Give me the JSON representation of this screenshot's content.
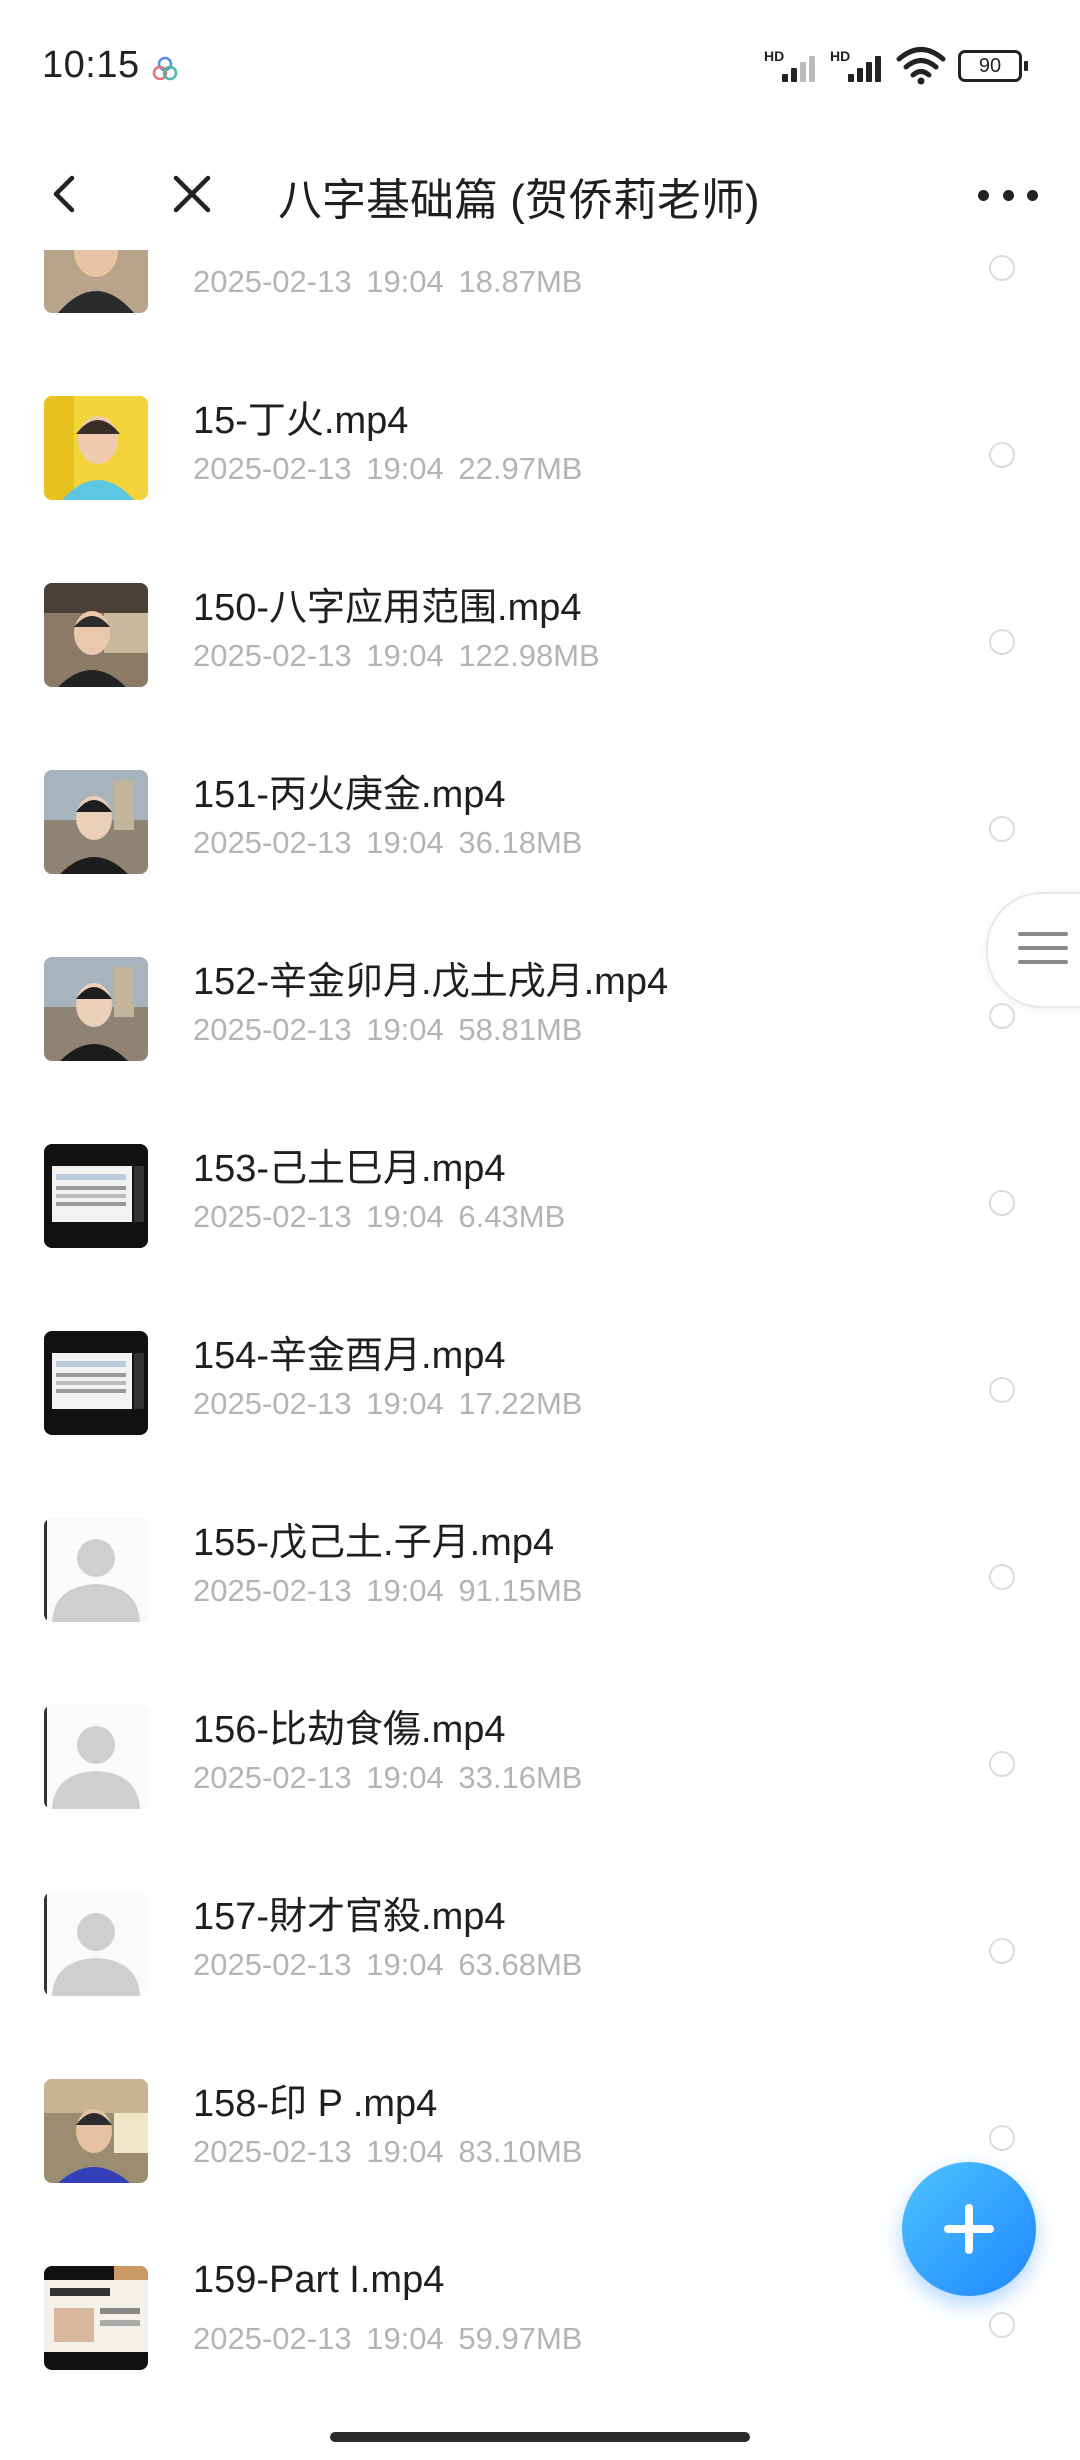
{
  "status_bar": {
    "time": "10:15",
    "signal_1_label": "HD",
    "signal_2_label": "HD",
    "battery": "90"
  },
  "header": {
    "title": "八字基础篇 (贺侨莉老师)",
    "back_icon": "chevron-left",
    "close_icon": "x",
    "more_icon": "ellipsis-horizontal"
  },
  "files": [
    {
      "name": "",
      "date": "2025-02-13",
      "time": "19:04",
      "size": "18.87MB",
      "thumb": "person-office"
    },
    {
      "name": "15-丁火.mp4",
      "date": "2025-02-13",
      "time": "19:04",
      "size": "22.97MB",
      "thumb": "person-yellow"
    },
    {
      "name": "150-八字应用范围.mp4",
      "date": "2025-02-13",
      "time": "19:04",
      "size": "122.98MB",
      "thumb": "person-room"
    },
    {
      "name": "151-丙火庚金.mp4",
      "date": "2025-02-13",
      "time": "19:04",
      "size": "36.18MB",
      "thumb": "person-city"
    },
    {
      "name": "152-辛金卯月.戊土戌月.mp4",
      "date": "2025-02-13",
      "time": "19:04",
      "size": "58.81MB",
      "thumb": "person-city"
    },
    {
      "name": "153-己土巳月.mp4",
      "date": "2025-02-13",
      "time": "19:04",
      "size": "6.43MB",
      "thumb": "screen-table"
    },
    {
      "name": "154-辛金酉月.mp4",
      "date": "2025-02-13",
      "time": "19:04",
      "size": "17.22MB",
      "thumb": "screen-table"
    },
    {
      "name": "155-戊己土.子月.mp4",
      "date": "2025-02-13",
      "time": "19:04",
      "size": "91.15MB",
      "thumb": "avatar-placeholder"
    },
    {
      "name": "156-比劫食傷.mp4",
      "date": "2025-02-13",
      "time": "19:04",
      "size": "33.16MB",
      "thumb": "avatar-placeholder"
    },
    {
      "name": "157-財才官殺.mp4",
      "date": "2025-02-13",
      "time": "19:04",
      "size": "63.68MB",
      "thumb": "avatar-placeholder"
    },
    {
      "name": "158-印 P .mp4",
      "date": "2025-02-13",
      "time": "19:04",
      "size": "83.10MB",
      "thumb": "person-room-blue"
    },
    {
      "name": "159-Part I.mp4",
      "date": "2025-02-13",
      "time": "19:04",
      "size": "59.97MB",
      "thumb": "screen-slide"
    }
  ],
  "fab_icon": "plus",
  "side_handle_icon": "menu-lines",
  "colors": {
    "accent": "#1f86ff",
    "meta_text": "#b4b4b4",
    "title_text": "#1f1f1f"
  }
}
